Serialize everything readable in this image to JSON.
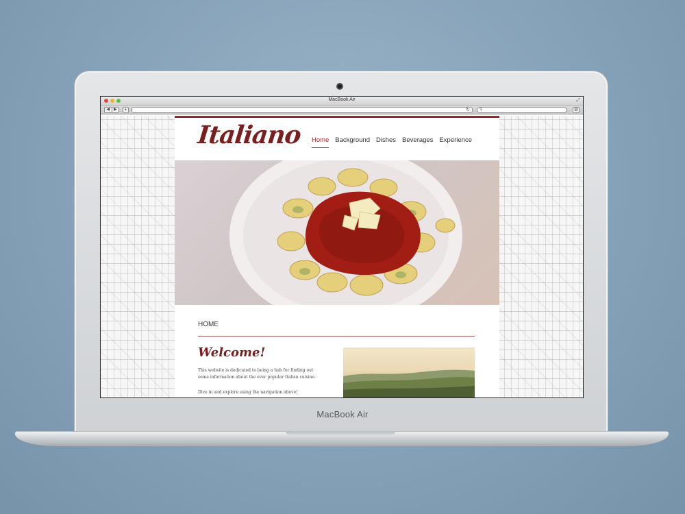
{
  "device": {
    "label": "MacBook Air"
  },
  "browser": {
    "window_title": "MacBook Air",
    "nav_back": "◀",
    "nav_forward": "▶",
    "add_tab": "+",
    "url": "",
    "search_placeholder": "",
    "reload_icon": "reload-icon",
    "search_icon": "search-icon"
  },
  "site": {
    "logo": "Italiano",
    "nav": [
      {
        "label": "Home",
        "active": true
      },
      {
        "label": "Background",
        "active": false
      },
      {
        "label": "Dishes",
        "active": false
      },
      {
        "label": "Beverages",
        "active": false
      },
      {
        "label": "Experience",
        "active": false
      }
    ],
    "hero_image": "tortellini-with-bolognese-photo",
    "page_heading": "HOME",
    "welcome_title": "Welcome!",
    "paragraph_1": "This website is dedicated to being a hub for finding out some information about the ever popular Italian cuisine.",
    "paragraph_2": "Dive in and explore using the navigation above!",
    "side_image": "italian-countryside-photo"
  },
  "colors": {
    "brand": "#7a1f1f",
    "accent": "#9c2b2b",
    "page_background": "#86a2b8"
  }
}
